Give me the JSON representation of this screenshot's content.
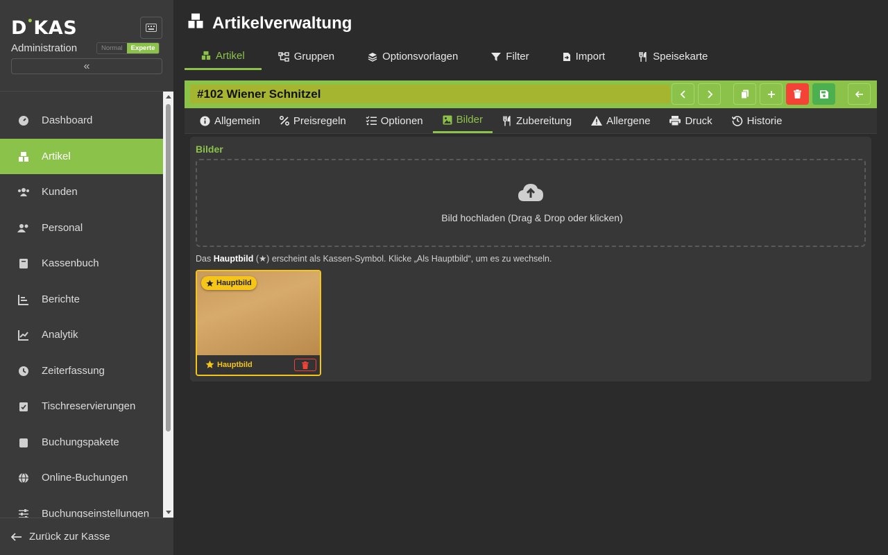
{
  "brand": {
    "name_pre": "D",
    "name_dot": "•",
    "name_post": "KAS",
    "subtitle": "Administration"
  },
  "mode": {
    "normal": "Normal",
    "expert": "Experte"
  },
  "sidebar": {
    "items": [
      {
        "label": "Dashboard",
        "icon": "dashboard-icon"
      },
      {
        "label": "Artikel",
        "icon": "boxes-icon"
      },
      {
        "label": "Kunden",
        "icon": "users-icon"
      },
      {
        "label": "Personal",
        "icon": "user-group-icon"
      },
      {
        "label": "Kassenbuch",
        "icon": "book-icon"
      },
      {
        "label": "Berichte",
        "icon": "bar-chart-icon"
      },
      {
        "label": "Analytik",
        "icon": "line-chart-icon"
      },
      {
        "label": "Zeiterfassung",
        "icon": "clock-icon"
      },
      {
        "label": "Tischreservierungen",
        "icon": "calendar-check-icon"
      },
      {
        "label": "Buchungspakete",
        "icon": "package-icon"
      },
      {
        "label": "Online-Buchungen",
        "icon": "globe-icon"
      },
      {
        "label": "Buchungseinstellungen",
        "icon": "sliders-icon"
      }
    ],
    "back_label": "Zurück zur Kasse"
  },
  "page": {
    "title": "Artikelverwaltung"
  },
  "top_tabs": [
    {
      "label": "Artikel",
      "icon": "boxes-icon"
    },
    {
      "label": "Gruppen",
      "icon": "sitemap-icon"
    },
    {
      "label": "Optionsvorlagen",
      "icon": "layers-icon"
    },
    {
      "label": "Filter",
      "icon": "filter-icon"
    },
    {
      "label": "Import",
      "icon": "file-import-icon"
    },
    {
      "label": "Speisekarte",
      "icon": "utensils-icon"
    }
  ],
  "article": {
    "name": "#102 Wiener Schnitzel"
  },
  "sub_tabs": [
    {
      "label": "Allgemein",
      "icon": "info-icon"
    },
    {
      "label": "Preisregeln",
      "icon": "percent-icon"
    },
    {
      "label": "Optionen",
      "icon": "list-check-icon"
    },
    {
      "label": "Bilder",
      "icon": "image-icon"
    },
    {
      "label": "Zubereitung",
      "icon": "utensils-icon"
    },
    {
      "label": "Allergene",
      "icon": "warning-icon"
    },
    {
      "label": "Druck",
      "icon": "printer-icon"
    },
    {
      "label": "Historie",
      "icon": "history-icon"
    }
  ],
  "bilder": {
    "heading": "Bilder",
    "upload_text": "Bild hochladen (Drag & Drop oder klicken)",
    "hint_pre": "Das ",
    "hint_bold": "Hauptbild",
    "hint_post": " (★) erscheint als Kassen-Symbol. Klicke „Als Hauptbild“, um es zu wechseln.",
    "badge": "Hauptbild",
    "footer_label": "Hauptbild"
  },
  "colors": {
    "accent": "#8bc34a",
    "danger": "#f44336",
    "save": "#4caf50",
    "star": "#f5c518"
  }
}
